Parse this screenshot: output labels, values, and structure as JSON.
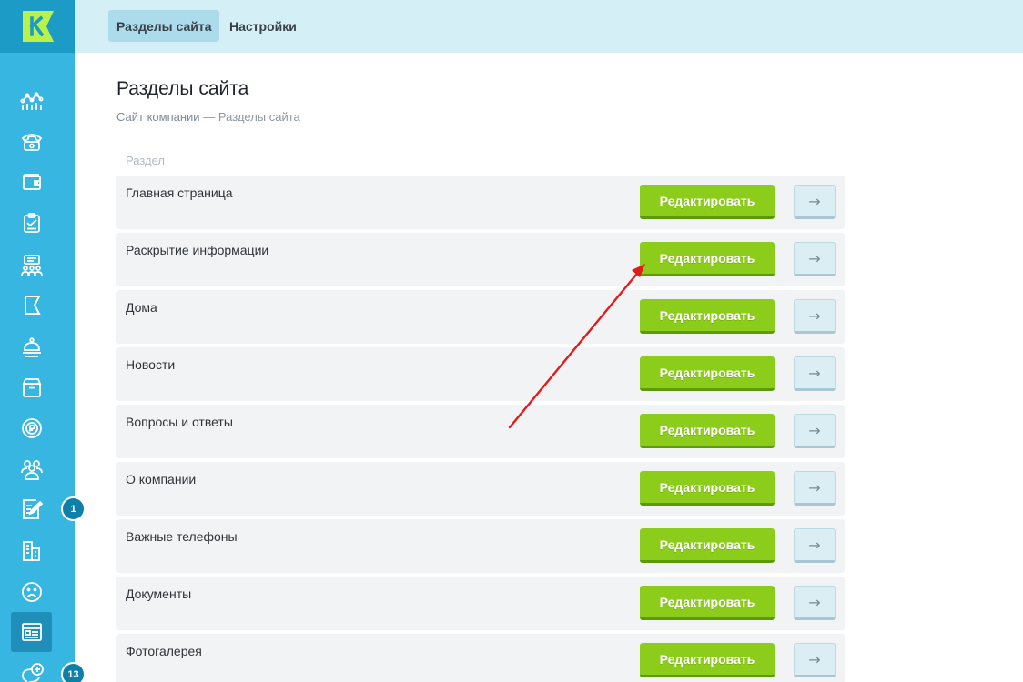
{
  "brand": {
    "logo_letter": "K",
    "accent": "#38b6e2",
    "button_green": "#8ccc1b"
  },
  "sidebar": {
    "items": [
      {
        "icon": "analytics-icon"
      },
      {
        "icon": "phone-icon"
      },
      {
        "icon": "wallet-icon"
      },
      {
        "icon": "clipboard-check-icon"
      },
      {
        "icon": "meeting-icon"
      },
      {
        "icon": "flag-icon"
      },
      {
        "icon": "service-bell-icon"
      },
      {
        "icon": "archive-box-icon"
      },
      {
        "icon": "coin-icon"
      },
      {
        "icon": "group-icon"
      },
      {
        "icon": "edit-note-icon",
        "badge": "1"
      },
      {
        "icon": "building-icon"
      },
      {
        "icon": "sad-face-icon"
      },
      {
        "icon": "website-sections-icon",
        "active": true
      },
      {
        "icon": "chat-add-icon",
        "badge": "13"
      }
    ]
  },
  "topbar": {
    "tabs": [
      {
        "label": "Разделы сайта",
        "active": true
      },
      {
        "label": "Настройки",
        "active": false
      }
    ]
  },
  "page": {
    "title": "Разделы сайта",
    "breadcrumb": {
      "link": "Сайт компании",
      "separator": "—",
      "current": "Разделы сайта"
    },
    "column_header": "Раздел"
  },
  "sections": [
    {
      "title": "Главная страница",
      "edit_label": "Редактировать",
      "go_label": "→"
    },
    {
      "title": "Раскрытие информации",
      "edit_label": "Редактировать",
      "go_label": "→"
    },
    {
      "title": "Дома",
      "edit_label": "Редактировать",
      "go_label": "→"
    },
    {
      "title": "Новости",
      "edit_label": "Редактировать",
      "go_label": "→"
    },
    {
      "title": "Вопросы и ответы",
      "edit_label": "Редактировать",
      "go_label": "→"
    },
    {
      "title": "О компании",
      "edit_label": "Редактировать",
      "go_label": "→"
    },
    {
      "title": "Важные телефоны",
      "edit_label": "Редактировать",
      "go_label": "→"
    },
    {
      "title": "Документы",
      "edit_label": "Редактировать",
      "go_label": "→"
    },
    {
      "title": "Фотогалерея",
      "edit_label": "Редактировать",
      "go_label": "→"
    }
  ],
  "annotation": {
    "color": "#e31b1b",
    "points_to": "Раскрытие информации"
  }
}
